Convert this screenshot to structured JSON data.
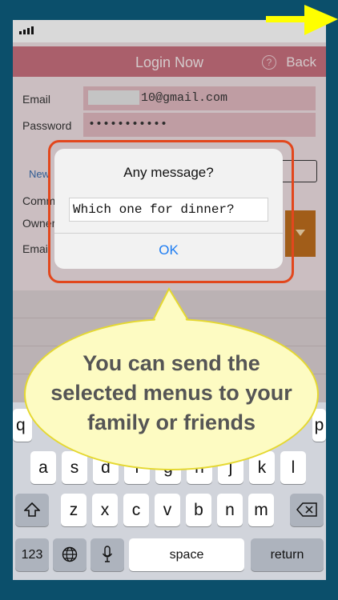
{
  "app": {
    "nav_title": "Login Now",
    "help_icon": "?",
    "back_label": "Back",
    "email_label": "Email",
    "email_value": "10@gmail.com",
    "password_label": "Password",
    "password_value": "•••••••••••",
    "new_label": "New",
    "comm_label": "Comm",
    "owner_label": "Owner",
    "email_label2": "Emai"
  },
  "alert": {
    "title": "Any message?",
    "input_value": "Which one for dinner?",
    "ok_label": "OK"
  },
  "callout": {
    "lines": [
      "You can send the",
      "selected menus to your",
      "family or friends"
    ]
  },
  "keyboard": {
    "row2": [
      "a",
      "s",
      "d",
      "f",
      "g",
      "h",
      "j",
      "k",
      "l"
    ],
    "row3": [
      "z",
      "x",
      "c",
      "v",
      "b",
      "n",
      "m"
    ],
    "numbers_label": "123",
    "space_label": "space",
    "return_label": "return",
    "row1_left": "q",
    "row1_right": "p"
  },
  "colors": {
    "frame": "#0b4f6b",
    "navbar": "#c26d7a",
    "callout_fill": "#fdfbc2",
    "highlight": "#e2471d",
    "arrow": "#ffff00",
    "link": "#1d7cf2"
  }
}
